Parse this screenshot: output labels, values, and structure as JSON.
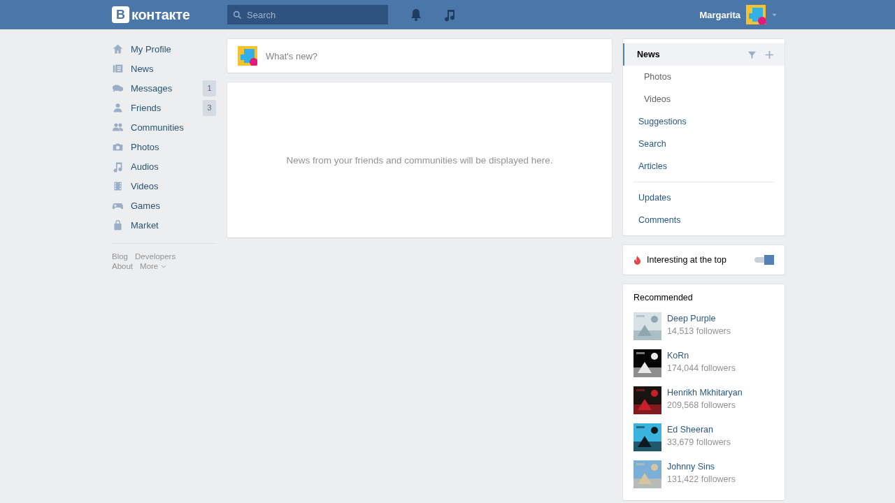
{
  "header": {
    "logo": {
      "mark": "В",
      "text": "контакте"
    },
    "search": {
      "placeholder": "Search"
    },
    "user": {
      "name": "Margarita"
    }
  },
  "sidebar": {
    "items": [
      {
        "kind": "home",
        "label": "My Profile"
      },
      {
        "kind": "news",
        "label": "News"
      },
      {
        "kind": "messages",
        "label": "Messages",
        "count": "1"
      },
      {
        "kind": "friends",
        "label": "Friends",
        "count": "3"
      },
      {
        "kind": "communities",
        "label": "Communities"
      },
      {
        "kind": "photos",
        "label": "Photos"
      },
      {
        "kind": "audios",
        "label": "Audios"
      },
      {
        "kind": "videos",
        "label": "Videos"
      },
      {
        "kind": "games",
        "label": "Games"
      },
      {
        "kind": "market",
        "label": "Market"
      }
    ],
    "footer_links": [
      [
        "Blog",
        "Developers"
      ],
      [
        "About",
        "More"
      ]
    ]
  },
  "composer": {
    "placeholder": "What's new?"
  },
  "feed": {
    "empty_message": "News from your friends and communities will be displayed here."
  },
  "news_menu": {
    "groups": [
      [
        {
          "label": "News",
          "selected": true,
          "children": [
            {
              "label": "Photos",
              "selected": false
            },
            {
              "label": "Videos",
              "selected": false
            }
          ]
        },
        {
          "label": "Suggestions",
          "selected": false
        },
        {
          "label": "Search",
          "selected": false
        },
        {
          "label": "Articles",
          "selected": false
        }
      ],
      [
        {
          "label": "Updates",
          "selected": false
        },
        {
          "label": "Comments",
          "selected": false
        }
      ]
    ]
  },
  "interesting": {
    "label": "Interesting at the top",
    "on": true
  },
  "recommended": {
    "title": "Recommended",
    "items": [
      {
        "name": "Deep Purple",
        "followers": "14,513 followers"
      },
      {
        "name": "KoRn",
        "followers": "174,044 followers"
      },
      {
        "name": "Henrikh Mkhitaryan",
        "followers": "209,568 followers"
      },
      {
        "name": "Ed Sheeran",
        "followers": "33,679 followers"
      },
      {
        "name": "Johnny Sins",
        "followers": "131,422 followers"
      }
    ]
  }
}
